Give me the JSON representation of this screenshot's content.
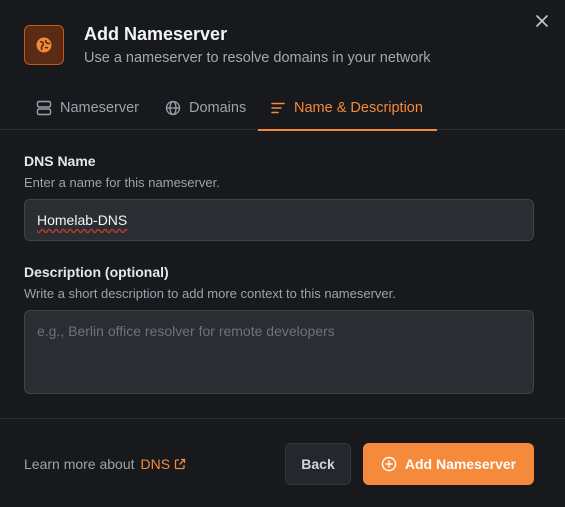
{
  "dialog": {
    "title": "Add Nameserver",
    "subtitle": "Use a nameserver to resolve domains in your network"
  },
  "tabs": [
    {
      "label": "Nameserver",
      "icon": "server-icon",
      "active": false
    },
    {
      "label": "Domains",
      "icon": "globe-icon",
      "active": false
    },
    {
      "label": "Name & Description",
      "icon": "lines-icon",
      "active": true
    }
  ],
  "dns_name": {
    "label": "DNS Name",
    "help": "Enter a name for this nameserver.",
    "value": "Homelab-DNS"
  },
  "description": {
    "label": "Description (optional)",
    "help": "Write a short description to add more context to this nameserver.",
    "placeholder": "e.g., Berlin office resolver for remote developers",
    "value": ""
  },
  "footer": {
    "learn_text": "Learn more about",
    "learn_link": "DNS",
    "back_label": "Back",
    "add_label": "Add Nameserver"
  },
  "colors": {
    "accent": "#f58a3a",
    "background": "#17191c"
  }
}
